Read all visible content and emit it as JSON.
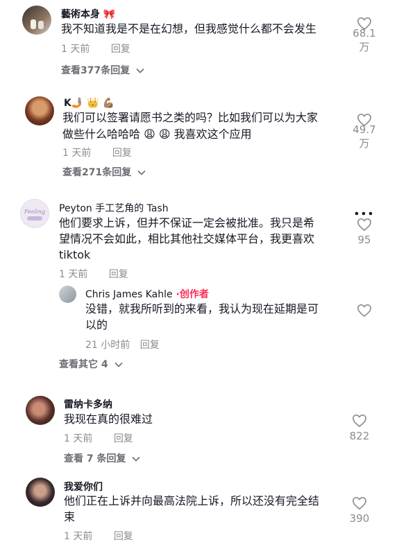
{
  "comments": [
    {
      "author": "藝術本身 🎀",
      "text": "我不知道我是不是在幻想，但我感觉什么都不会发生",
      "time": "1 天前",
      "reply_label": "回复",
      "like_count_line1": "68.1",
      "like_count_line2": "万",
      "view_replies": "查看377条回复"
    },
    {
      "author": "K🤳🏽 👑 💪🏽",
      "text_line1": "我们可以签署请愿书之类的吗？比如我们可以为大家",
      "text_line2": "做些什么哈哈哈 😩 😩 我喜欢这个应用",
      "time": "1 天前",
      "reply_label": "回复",
      "like_count_line1": "49.7",
      "like_count_line2": "万",
      "view_replies": "查看271条回复"
    },
    {
      "author": "Peyton 手工艺角的 Tash",
      "avatar_text": "Feeling",
      "text_line1": "他们要求上诉，但并不保证一定会被批准。我只是希",
      "text_line2": "望情况不会如此，相比其他社交媒体平台，我更喜欢",
      "text_line3": "tiktok",
      "time": "1 天前",
      "reply_label": "回复",
      "like_count": "95",
      "more_icon": "ellipsis-icon",
      "reply": {
        "author": "Chris James Kahle",
        "creator_tag": " ·创作者",
        "text_line1": "没错，就我所听到的来看，我认为现在延期是可",
        "text_line2": "以的",
        "time": "21 小时前",
        "reply_label": "回复"
      },
      "view_others": "查看其它 4"
    },
    {
      "author": "雷纳卡多纳",
      "text": "我现在真的很难过",
      "time": "1 天前",
      "reply_label": "回复",
      "like_count": "822",
      "view_replies": "查看 7 条回复"
    },
    {
      "author": "我爱你们",
      "text_line1": "他们正在上诉并向最高法院上诉，所以还没有完全结",
      "text_line2": "束",
      "time": "1 天前",
      "reply_label": "回复",
      "like_count": "390"
    }
  ],
  "colors": {
    "text": "#161823",
    "meta": "#8a8b91",
    "creator": "#fe2c55",
    "heart": "#8a8b91"
  }
}
